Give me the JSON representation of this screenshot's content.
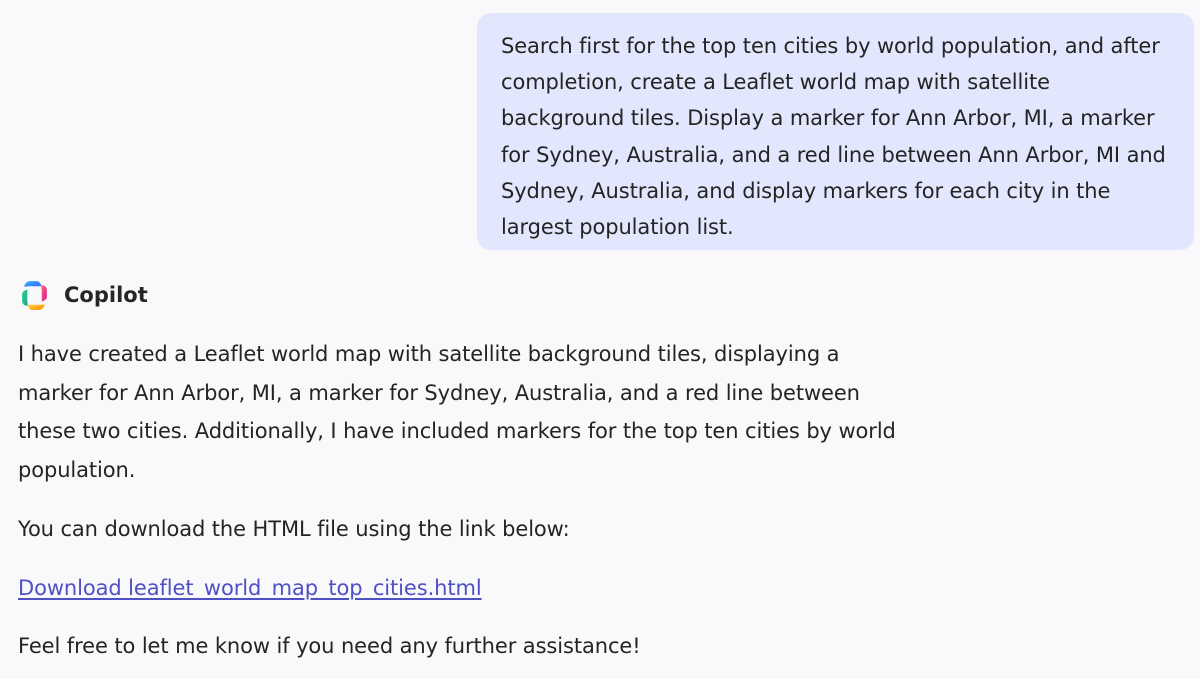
{
  "conversation": {
    "user_message": "Search first for the top ten cities by world population, and after completion, create a Leaflet world map with satellite background tiles. Display a marker for Ann Arbor, MI, a marker for Sydney, Australia, and a red line between Ann Arbor, MI and Sydney, Australia, and display markers for each city in the largest population list.",
    "assistant": {
      "name": "Copilot",
      "logo_icon": "copilot-logo-icon",
      "paragraphs": {
        "p1": "I have created a Leaflet world map with satellite background tiles, displaying a marker for Ann Arbor, MI, a marker for Sydney, Australia, and a red line between these two cities. Additionally, I have included markers for the top ten cities by world population.",
        "p2": "You can download the HTML file using the link below:",
        "link_text": "Download leaflet_world_map_top_cities.html",
        "p4": "Feel free to let me know if you need any further assistance!"
      }
    }
  },
  "colors": {
    "page_background": "#f9f9fb",
    "user_bubble_background": "#e3e7fd",
    "text": "#242424",
    "link": "#4f50c4"
  }
}
